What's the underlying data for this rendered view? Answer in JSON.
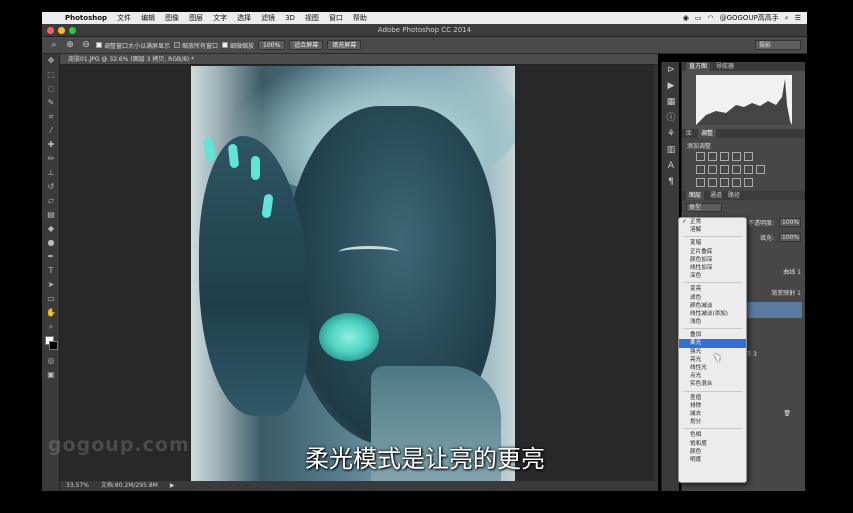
{
  "menubar": {
    "app": "Photoshop",
    "items": [
      "文件",
      "编辑",
      "图像",
      "图层",
      "文字",
      "选择",
      "滤镜",
      "3D",
      "视图",
      "窗口",
      "帮助"
    ],
    "user": "@GOGOUP高高手"
  },
  "window": {
    "title": "Adobe Photoshop CC 2014"
  },
  "options": {
    "resize_windows": "调整窗口大小以满屏显示",
    "zoom_all": "缩放所有窗口",
    "scrubby_zoom": "细微缩放",
    "zoom_percent": "100%",
    "fit_screen": "适合屏幕",
    "fill_screen": "填充屏幕",
    "workspace": "摄影"
  },
  "document": {
    "tab": "皮肤01.JPG @ 32.6% (图层 3 拷贝, RGB/8) *",
    "zoom": "33.57%",
    "doc_size": "文档:80.2M/295.8M"
  },
  "panels": {
    "histogram_tabs": [
      "直方图",
      "导航器"
    ],
    "adjust_tabs": [
      "库",
      "调整"
    ],
    "add_adjustment": "添加调整",
    "layer_tabs": [
      "图层",
      "通道",
      "路径"
    ],
    "kind": "类型",
    "opacity_label": "不透明度:",
    "opacity": "100%",
    "fill_label": "填充:",
    "fill": "100%",
    "layer_a": "曲线 1",
    "layer_b": "渐变映射 1",
    "layer_c": "贝 3"
  },
  "blend_menu": {
    "group1": [
      "正常",
      "溶解"
    ],
    "group2": [
      "变暗",
      "正片叠底",
      "颜色加深",
      "线性加深",
      "深色"
    ],
    "group3": [
      "变亮",
      "滤色",
      "颜色减淡",
      "线性减淡(添加)",
      "浅色"
    ],
    "group4": [
      "叠加",
      "柔光",
      "强光",
      "亮光",
      "线性光",
      "点光",
      "实色混合"
    ],
    "group5": [
      "差值",
      "排除",
      "减去",
      "划分"
    ],
    "group6": [
      "色相",
      "饱和度",
      "颜色",
      "明度"
    ],
    "checked": "正常",
    "highlighted": "柔光"
  },
  "watermark": "gogoup.com",
  "subtitle": "柔光模式是让亮的更亮",
  "colors": {
    "accent": "#2f6fd6",
    "teal": "#5fe6d8"
  },
  "icons": [
    "apple-icon",
    "zoom-tool-icon",
    "zoom-in-icon",
    "zoom-out-icon",
    "move-tool-icon",
    "marquee-tool-icon",
    "lasso-tool-icon",
    "brush-tool-icon",
    "wifi-icon"
  ]
}
